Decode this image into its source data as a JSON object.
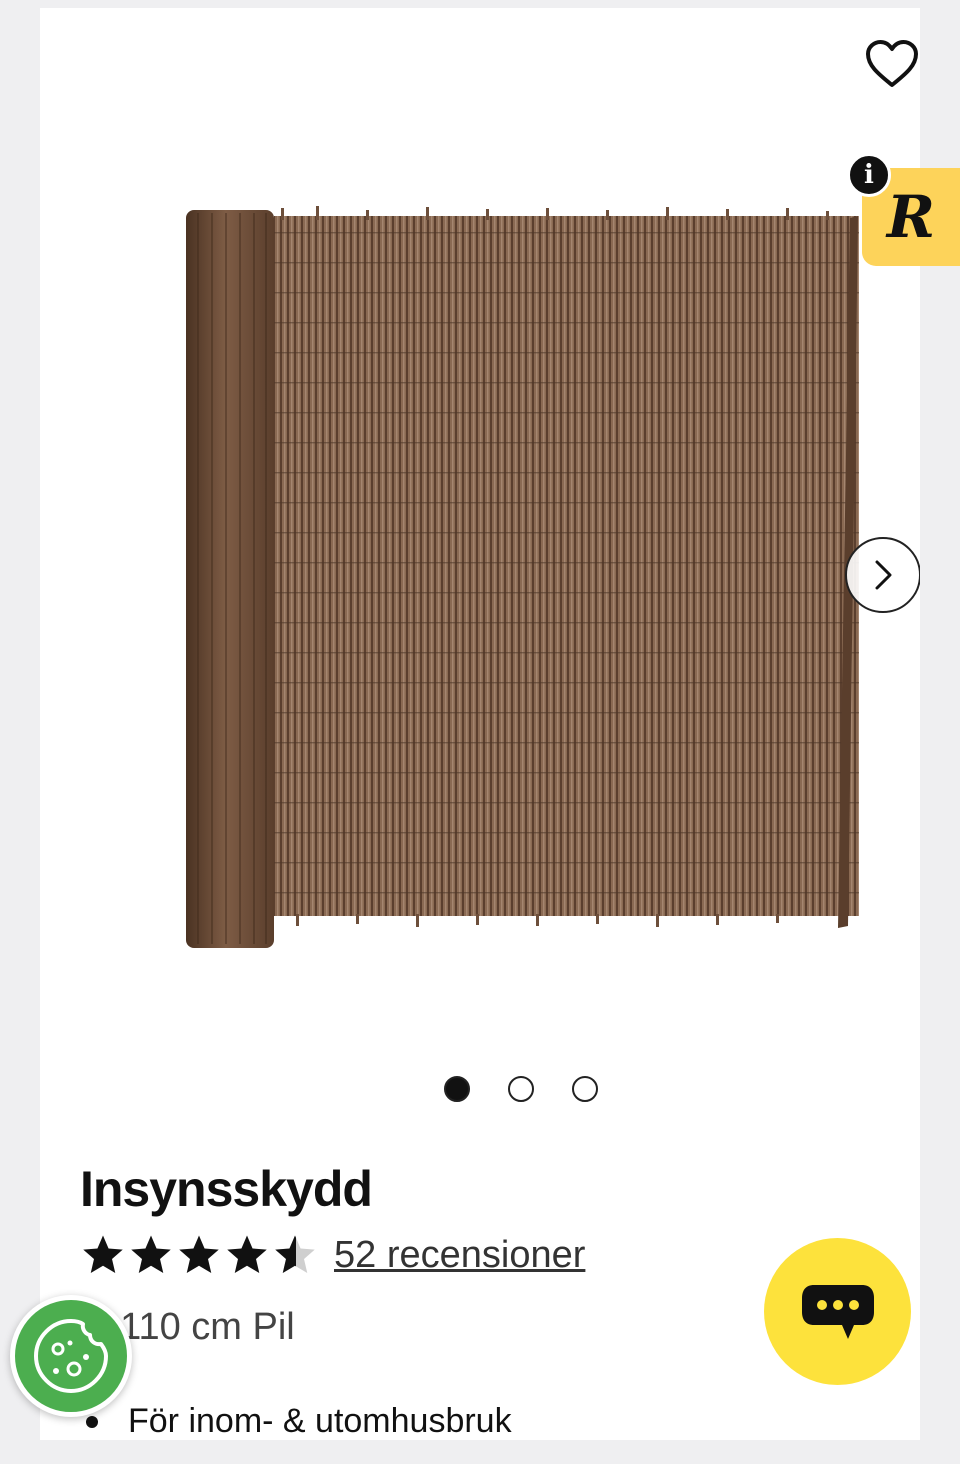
{
  "product": {
    "title": "Insynsskydd",
    "rating": 4.5,
    "rating_max": 5,
    "reviews_label": "52 recensioner",
    "variant": "0x110 cm Pil",
    "features": [
      "För inom- & utomhusbruk"
    ]
  },
  "gallery": {
    "image_count": 3,
    "active_index": 0,
    "next_icon": "chevron-right-icon"
  },
  "icons": {
    "favorite": "heart-outline-icon",
    "reviews_widget": "R",
    "info": "i",
    "chat": "chat-bubble-icon",
    "cookie": "cookie-icon"
  },
  "colors": {
    "reviews_widget_bg": "#fdd35a",
    "chat_bg": "#fde23c",
    "cookie_bg": "#4cae4f",
    "product_brown": "#7a5a44"
  }
}
